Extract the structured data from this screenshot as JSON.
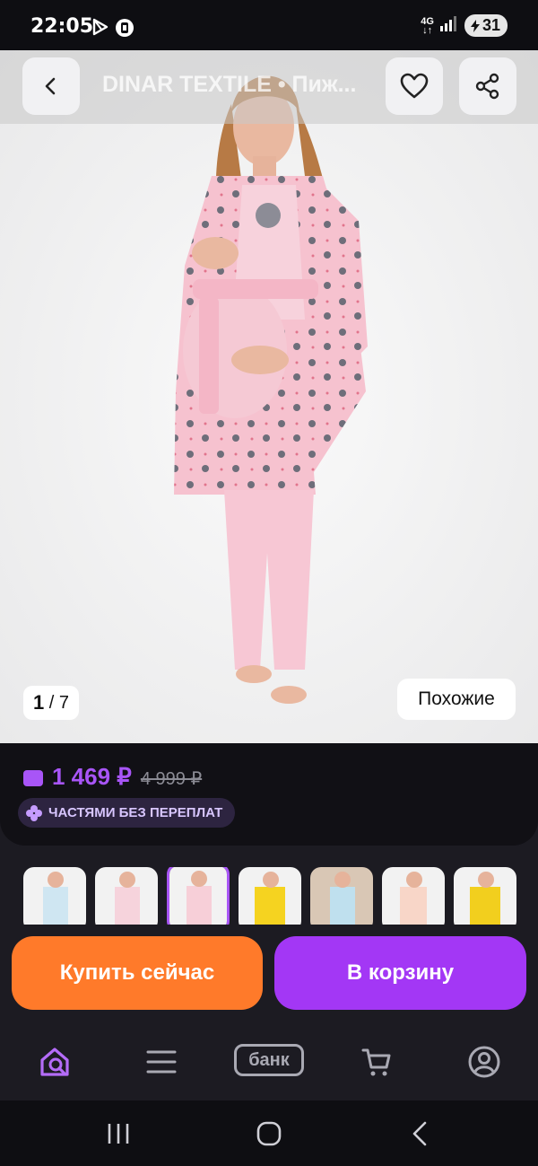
{
  "status": {
    "time": "22:05",
    "network": "4G",
    "battery": "31"
  },
  "header": {
    "title": "DINAR TEXTILE • Пиж..."
  },
  "gallery": {
    "current": "1",
    "total": "/ 7",
    "similar_label": "Похожие"
  },
  "product": {
    "price": "1 469 ₽",
    "old_price": "4 999 ₽",
    "installment_label": "ЧАСТЯМИ БЕЗ ПЕРЕПЛАТ",
    "accent_color": "#a855f7"
  },
  "thumbnails": [
    {
      "name": "thumb-blue-pajama",
      "color": "#cfe6f2"
    },
    {
      "name": "thumb-pink-robe",
      "color": "#f6d3dc"
    },
    {
      "name": "thumb-pink-robe-selected",
      "color": "#f7cfd8"
    },
    {
      "name": "thumb-yellow-1",
      "color": "#f5d320"
    },
    {
      "name": "thumb-blue-robe",
      "color": "#bfe0ee"
    },
    {
      "name": "thumb-peach",
      "color": "#f8d6c8"
    },
    {
      "name": "thumb-yellow-2",
      "color": "#f2cf1e"
    }
  ],
  "actions": {
    "buy_now": "Купить сейчас",
    "add_to_cart": "В корзину"
  },
  "bottom_nav": {
    "bank_label": "банк"
  }
}
